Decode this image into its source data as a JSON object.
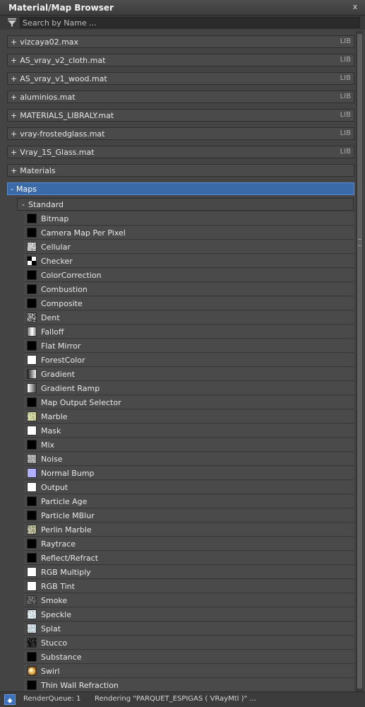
{
  "window": {
    "title": "Material/Map Browser",
    "close_glyph": "x"
  },
  "search": {
    "placeholder": "Search by Name ..."
  },
  "libraries": [
    {
      "label": "vizcaya02.max",
      "badge": "LIB"
    },
    {
      "label": "AS_vray_v2_cloth.mat",
      "badge": "LIB"
    },
    {
      "label": "AS_vray_v1_wood.mat",
      "badge": "LIB"
    },
    {
      "label": "aluminios.mat",
      "badge": "LIB"
    },
    {
      "label": "MATERIALS_LIBRALY.mat",
      "badge": "LIB"
    },
    {
      "label": "vray-frostedglass.mat",
      "badge": "LIB"
    },
    {
      "label": "Vray_1S_Glass.mat",
      "badge": "LIB"
    }
  ],
  "materials_group": {
    "label": "Materials"
  },
  "maps_group": {
    "label": "Maps"
  },
  "standard_group": {
    "label": "Standard"
  },
  "expand_glyph": "+",
  "collapse_glyph": "-",
  "maps": [
    {
      "name": "Bitmap",
      "swatch": "#000000"
    },
    {
      "name": "Camera Map Per Pixel",
      "swatch": "#000000"
    },
    {
      "name": "Cellular",
      "swatch": "cellular"
    },
    {
      "name": "Checker",
      "swatch": "checker"
    },
    {
      "name": "ColorCorrection",
      "swatch": "#000000"
    },
    {
      "name": "Combustion",
      "swatch": "#000000"
    },
    {
      "name": "Composite",
      "swatch": "#000000"
    },
    {
      "name": "Dent",
      "swatch": "dent"
    },
    {
      "name": "Falloff",
      "swatch": "falloff"
    },
    {
      "name": "Flat Mirror",
      "swatch": "#000000"
    },
    {
      "name": "ForestColor",
      "swatch": "#ffffff"
    },
    {
      "name": "Gradient",
      "swatch": "gradient"
    },
    {
      "name": "Gradient Ramp",
      "swatch": "gradient-ramp"
    },
    {
      "name": "Map Output Selector",
      "swatch": "#000000"
    },
    {
      "name": "Marble",
      "swatch": "marble"
    },
    {
      "name": "Mask",
      "swatch": "#ffffff"
    },
    {
      "name": "Mix",
      "swatch": "#000000"
    },
    {
      "name": "Noise",
      "swatch": "noise"
    },
    {
      "name": "Normal Bump",
      "swatch": "#b0b0ff"
    },
    {
      "name": "Output",
      "swatch": "#ffffff"
    },
    {
      "name": "Particle Age",
      "swatch": "#000000"
    },
    {
      "name": "Particle MBlur",
      "swatch": "#000000"
    },
    {
      "name": "Perlin Marble",
      "swatch": "perlin"
    },
    {
      "name": "Raytrace",
      "swatch": "#000000"
    },
    {
      "name": "Reflect/Refract",
      "swatch": "#000000"
    },
    {
      "name": "RGB Multiply",
      "swatch": "#ffffff"
    },
    {
      "name": "RGB Tint",
      "swatch": "#ffffff"
    },
    {
      "name": "Smoke",
      "swatch": "smoke"
    },
    {
      "name": "Speckle",
      "swatch": "speckle"
    },
    {
      "name": "Splat",
      "swatch": "splat"
    },
    {
      "name": "Stucco",
      "swatch": "stucco"
    },
    {
      "name": "Substance",
      "swatch": "#000000"
    },
    {
      "name": "Swirl",
      "swatch": "swirl"
    },
    {
      "name": "Thin Wall Refraction",
      "swatch": "#000000"
    }
  ],
  "status": {
    "queue": "RenderQueue: 1",
    "rendering": "Rendering \"PARQUET_ESPIGAS  ( VRayMtl )\" ..."
  },
  "icons": {
    "filter": "filter-funnel-icon",
    "status": "render-icon"
  }
}
